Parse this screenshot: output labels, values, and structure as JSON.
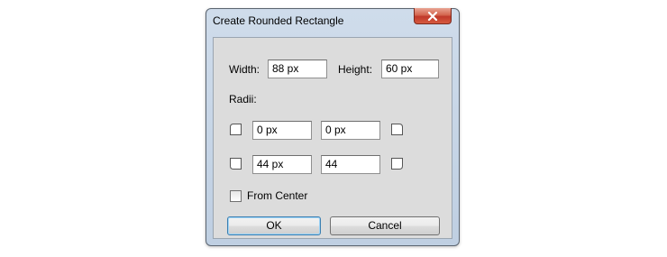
{
  "window": {
    "title": "Create Rounded Rectangle",
    "close_icon": "close-icon"
  },
  "size": {
    "width_label": "Width:",
    "width_value": "88 px",
    "height_label": "Height:",
    "height_value": "60 px"
  },
  "radii": {
    "label": "Radii:",
    "top_left": "0 px",
    "top_right": "0 px",
    "bottom_left": "44 px",
    "bottom_right": "44",
    "corner_icons": [
      "corner-top-left-icon",
      "corner-top-right-icon",
      "corner-bottom-left-icon",
      "corner-bottom-right-icon"
    ]
  },
  "from_center": {
    "label": "From Center",
    "checked": false
  },
  "buttons": {
    "ok": "OK",
    "cancel": "Cancel"
  },
  "colors": {
    "close_button": "#c0392b",
    "default_button_border": "#3c7fb1",
    "client_background": "#dcdcdc"
  }
}
